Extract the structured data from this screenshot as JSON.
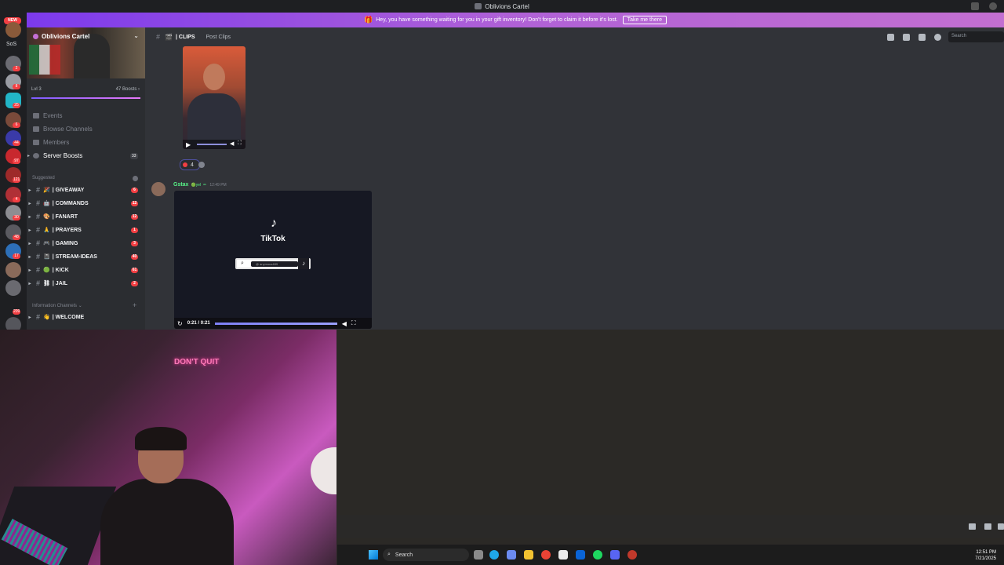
{
  "window": {
    "title": "Oblivions Cartel"
  },
  "banner": {
    "message": "Hey, you have something waiting for you in your gift inventory! Don't forget to claim it before it's lost.",
    "button": "Take me there"
  },
  "guilds": {
    "new_label": "NEW",
    "sos_label": "SoS",
    "badges": [
      "2",
      "8",
      "25",
      "6",
      "44",
      "97",
      "121",
      "4",
      "30",
      "48",
      "17",
      "209"
    ]
  },
  "server": {
    "name": "Oblivions Cartel",
    "level": "Lvl 3",
    "boosts": "47 Boosts"
  },
  "nav": [
    {
      "label": "Events",
      "count": ""
    },
    {
      "label": "Browse Channels",
      "count": ""
    },
    {
      "label": "Members",
      "count": ""
    },
    {
      "label": "Server Boosts",
      "count": "33"
    }
  ],
  "sections": {
    "suggested": "Suggested",
    "info": "Information Channels"
  },
  "channels": [
    {
      "emoji": "🎉",
      "label": "| GIVEAWAY",
      "count": "6"
    },
    {
      "emoji": "🤖",
      "label": "| COMMANDS",
      "count": "12"
    },
    {
      "emoji": "🎨",
      "label": "| FANART",
      "count": "12"
    },
    {
      "emoji": "🙏",
      "label": "| PRAYERS",
      "count": "1"
    },
    {
      "emoji": "🎮",
      "label": "| GAMING",
      "count": "3"
    },
    {
      "emoji": "📓",
      "label": "| STREAM-IDEAS",
      "count": "40"
    },
    {
      "emoji": "🟢",
      "label": "| KICK",
      "count": "61"
    },
    {
      "emoji": "⛓",
      "label": "| JAIL",
      "count": "2"
    }
  ],
  "info_channel": {
    "emoji": "👋",
    "label": "| WELCOME"
  },
  "header": {
    "channel": "| CLIPS",
    "post": "Post Clips",
    "search_placeholder": "Search"
  },
  "message1": {
    "reaction_count": "4"
  },
  "message2": {
    "author": "Gstax",
    "tag": "yel",
    "time": "12:49 PM"
  },
  "tiktok": {
    "brand": "TikTok",
    "handle": "@ anymous489",
    "time": "0:21 / 0:21"
  },
  "stream": {
    "sign": "DON'T QUIT"
  },
  "taskbar": {
    "search": "Search",
    "time": "12:51 PM",
    "date": "7/21/2025"
  },
  "colors": {
    "accent": "#b061d6",
    "online": "#57f287",
    "mention": "#f23f43"
  }
}
